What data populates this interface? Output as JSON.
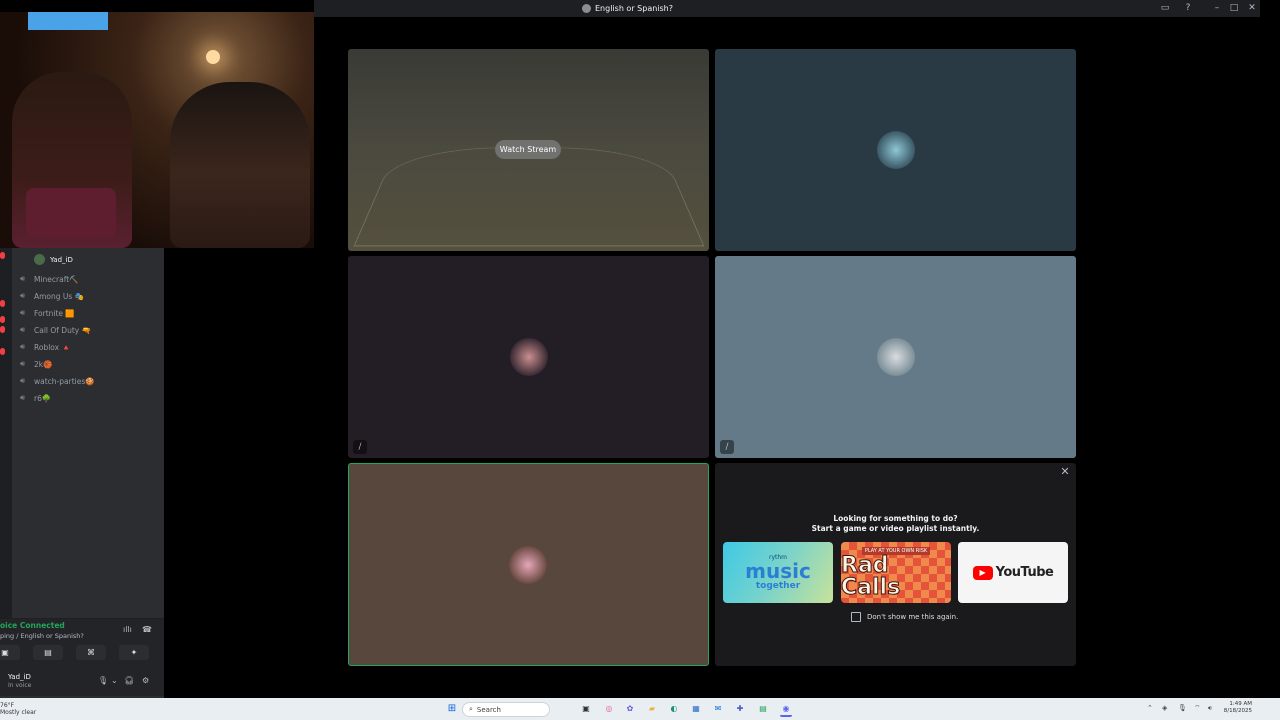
{
  "window": {
    "title": "English or Spanish?",
    "controls": [
      "inbox-icon",
      "help-icon",
      "minimize-icon",
      "maximize-icon",
      "close-icon"
    ]
  },
  "sidebar": {
    "channel_owner": "Yad_iD",
    "channels": [
      {
        "label": "Minecraft⛏️"
      },
      {
        "label": "Among Us 🎭"
      },
      {
        "label": "Fortnite 🟧"
      },
      {
        "label": "Call Of Duty 🔫"
      },
      {
        "label": "Roblox 🔺"
      },
      {
        "label": "2k🏀"
      },
      {
        "label": "watch-parties🍪"
      },
      {
        "label": "r6🌳"
      }
    ]
  },
  "voice_panel": {
    "status": "oice Connected",
    "location": "ping / English or Spanish?"
  },
  "user_panel": {
    "username": "Yad_iD",
    "status": "In voice"
  },
  "grid": {
    "watch_stream_label": "Watch Stream"
  },
  "activity_prompt": {
    "title_line1": "Looking for something to do?",
    "title_line2": "Start a game or video playlist instantly.",
    "cards": [
      {
        "name": "rythm music together",
        "line1": "rythm",
        "line2": "music",
        "line3": "together"
      },
      {
        "name": "Rad Calls",
        "line1": "PLAY AT YOUR OWN RISK",
        "line2": "Rad Calls"
      },
      {
        "name": "YouTube",
        "line1": "YouTube"
      }
    ],
    "dont_show_label": "Don't show me this again."
  },
  "taskbar": {
    "weather_line1": "76°F",
    "weather_line2": "Mostly clear",
    "search_placeholder": "Search",
    "time": "1:49 AM",
    "date": "8/18/2025"
  },
  "colors": {
    "connected_green": "#23a55a",
    "speaking_border": "#23a55a",
    "tile_dark_teal": "#2a3a44",
    "tile_purple_dark": "#231d26",
    "tile_slate": "#647a88",
    "tile_brown": "#57473d"
  }
}
